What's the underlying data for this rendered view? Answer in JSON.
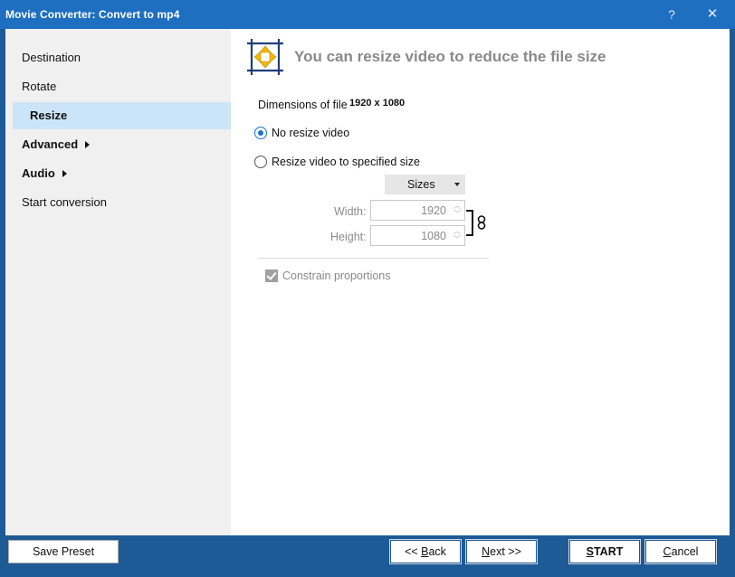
{
  "window": {
    "title": "Movie Converter:  Convert to mp4",
    "help_glyph": "?",
    "close_glyph": "✕"
  },
  "sidebar": {
    "items": [
      {
        "label": "Destination"
      },
      {
        "label": "Rotate"
      },
      {
        "label": "Resize"
      },
      {
        "label": "Advanced"
      },
      {
        "label": "Audio"
      },
      {
        "label": "Start conversion"
      }
    ],
    "active_index": 2
  },
  "header": {
    "title": "You can resize video to reduce the file size",
    "icon": "resize-icon"
  },
  "resize": {
    "dimensions_label": "Dimensions of file",
    "dimensions_value": "1920 x 1080",
    "option_no_resize": "No resize video",
    "option_resize": "Resize video to specified size",
    "selected_option": "No resize video",
    "sizes_button": "Sizes",
    "width_label": "Width:",
    "width_value": "1920",
    "height_label": "Height:",
    "height_value": "1080",
    "constrain_label": "Constrain proportions",
    "constrain_checked": true
  },
  "footer": {
    "save_preset": "Save Preset",
    "back_prefix": "<< ",
    "back_accel": "B",
    "back_rest": "ack",
    "next_accel": "N",
    "next_rest": "ext >>",
    "start_accel": "S",
    "start_rest": "TART",
    "cancel_accel": "C",
    "cancel_rest": "ancel"
  },
  "colors": {
    "titlebar": "#1f6fc1",
    "bottombar": "#1e5a96",
    "active_nav": "#cce4f7",
    "radio_accent": "#1a73d0",
    "icon_accent": "#f2b800"
  }
}
